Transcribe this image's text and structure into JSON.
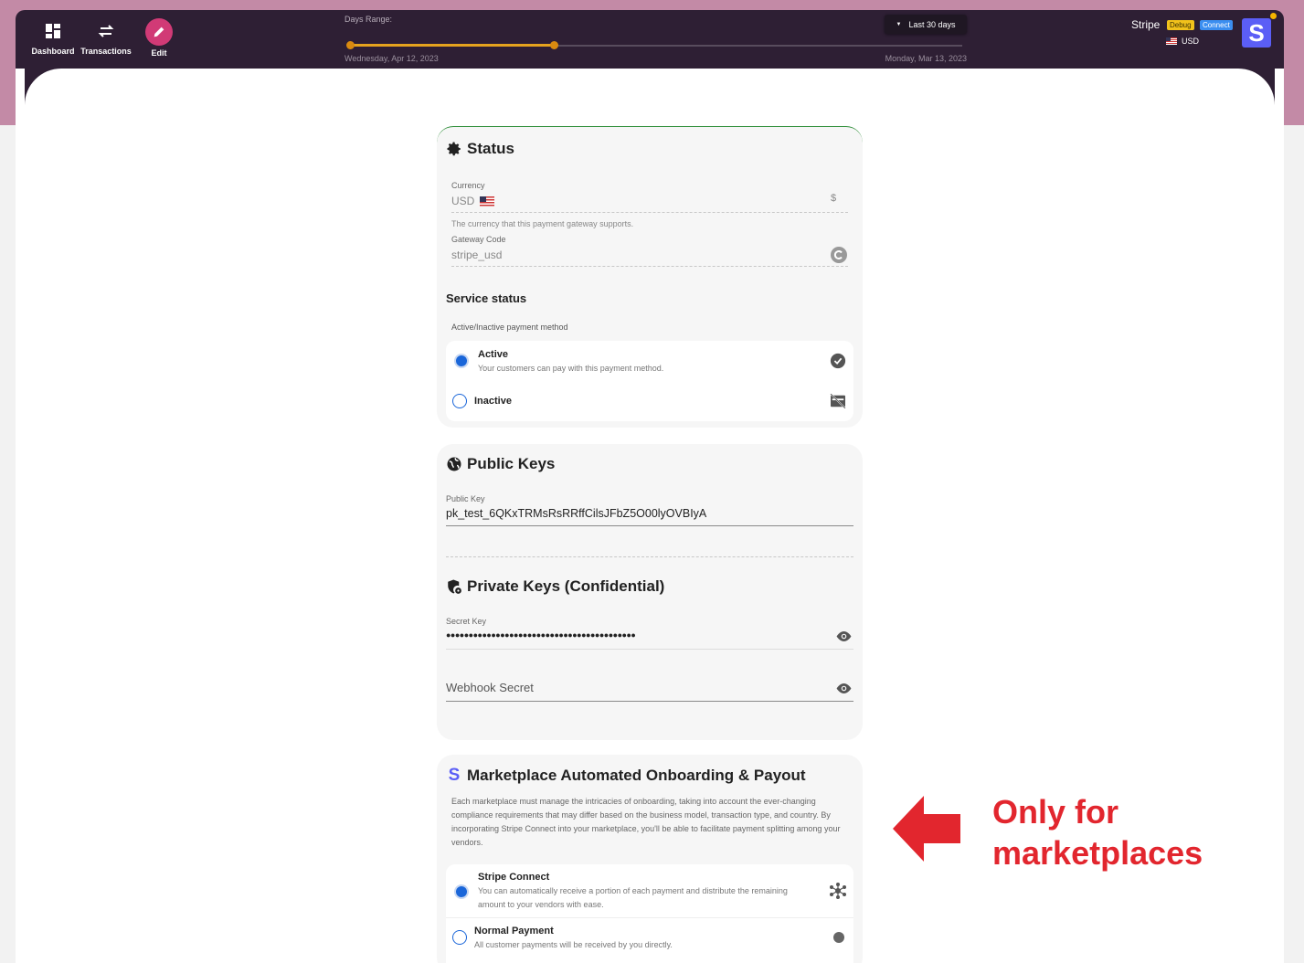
{
  "nav": {
    "dashboard": "Dashboard",
    "transactions": "Transactions",
    "edit": "Edit"
  },
  "range": {
    "label": "Days Range:",
    "start_date": "Wednesday, Apr 12, 2023",
    "end_date": "Monday, Mar 13, 2023",
    "preset": "Last 30 days"
  },
  "account": {
    "name": "Stripe",
    "badge_debug": "Debug",
    "badge_connect": "Connect",
    "currency": "USD",
    "avatar_letter": "S"
  },
  "status_card": {
    "title": "Status",
    "currency_label": "Currency",
    "currency_value": "USD",
    "currency_symbol": "$",
    "currency_help": "The currency that this payment gateway supports.",
    "gateway_label": "Gateway Code",
    "gateway_value": "stripe_usd",
    "service_title": "Service status",
    "service_sub": "Active/Inactive payment method",
    "active_title": "Active",
    "active_desc": "Your customers can pay with this payment method.",
    "inactive_title": "Inactive"
  },
  "keys_card": {
    "public_title": "Public Keys",
    "public_label": "Public Key",
    "public_value": "pk_test_6QKxTRMsRsRRffCilsJFbZ5O00lyOVBIyA",
    "private_title": "Private Keys (Confidential)",
    "secret_label": "Secret Key",
    "secret_value": "●●●●●●●●●●●●●●●●●●●●●●●●●●●●●●●●●●●●●●●●●●",
    "webhook_label": "Webhook Secret"
  },
  "market_card": {
    "title": "Marketplace Automated Onboarding & Payout",
    "description": "Each marketplace must manage the intricacies of onboarding, taking into account the ever-changing compliance requirements that may differ based on the business model, transaction type, and country. By incorporating Stripe Connect into your marketplace, you'll be able to facilitate payment splitting among your vendors.",
    "connect_title": "Stripe Connect",
    "connect_desc": "You can automatically receive a portion of each payment and distribute the remaining amount to your vendors with ease.",
    "normal_title": "Normal Payment",
    "normal_desc": "All customer payments will be received by you directly."
  },
  "annotation": {
    "line1": "Only for",
    "line2": "marketplaces",
    "color": "#e2262e"
  }
}
